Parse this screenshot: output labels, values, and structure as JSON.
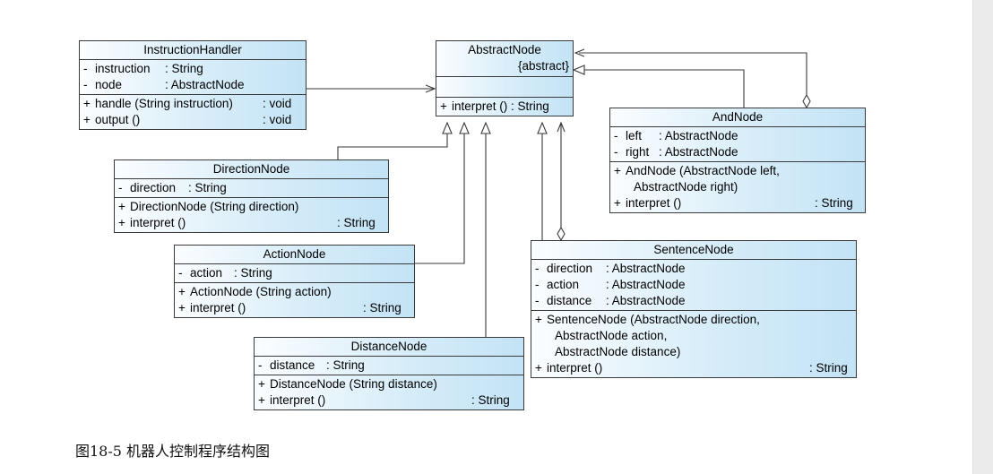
{
  "classes": {
    "instruction_handler": {
      "name": "InstructionHandler",
      "attributes": [
        {
          "vis": "-",
          "name": "instruction",
          "type": ": String"
        },
        {
          "vis": "-",
          "name": "node",
          "type": ": AbstractNode"
        }
      ],
      "operations": [
        {
          "vis": "+",
          "name": "handle (String instruction)",
          "type": ": void"
        },
        {
          "vis": "+",
          "name": "output ()",
          "type": ": void"
        }
      ]
    },
    "abstract_node": {
      "name": "AbstractNode",
      "stereotype": "{abstract}",
      "operations": [
        {
          "vis": "+",
          "name": "interpret () : String"
        }
      ]
    },
    "and_node": {
      "name": "AndNode",
      "attributes": [
        {
          "vis": "-",
          "name": "left",
          "type": ": AbstractNode"
        },
        {
          "vis": "-",
          "name": "right",
          "type": ": AbstractNode"
        }
      ],
      "operations": [
        {
          "vis": "+",
          "name": "AndNode (AbstractNode left,",
          "cont": "AbstractNode right)"
        },
        {
          "vis": "+",
          "name": "interpret ()",
          "type": ": String"
        }
      ]
    },
    "direction_node": {
      "name": "DirectionNode",
      "attributes": [
        {
          "vis": "-",
          "name": "direction",
          "type": ": String"
        }
      ],
      "operations": [
        {
          "vis": "+",
          "name": "DirectionNode (String direction)"
        },
        {
          "vis": "+",
          "name": "interpret ()",
          "type": ": String"
        }
      ]
    },
    "action_node": {
      "name": "ActionNode",
      "attributes": [
        {
          "vis": "-",
          "name": "action",
          "type": ": String"
        }
      ],
      "operations": [
        {
          "vis": "+",
          "name": "ActionNode (String action)"
        },
        {
          "vis": "+",
          "name": "interpret ()",
          "type": ": String"
        }
      ]
    },
    "distance_node": {
      "name": "DistanceNode",
      "attributes": [
        {
          "vis": "-",
          "name": "distance",
          "type": ": String"
        }
      ],
      "operations": [
        {
          "vis": "+",
          "name": "DistanceNode (String distance)"
        },
        {
          "vis": "+",
          "name": "interpret ()",
          "type": ": String"
        }
      ]
    },
    "sentence_node": {
      "name": "SentenceNode",
      "attributes": [
        {
          "vis": "-",
          "name": "direction",
          "type": ": AbstractNode"
        },
        {
          "vis": "-",
          "name": "action",
          "type": ": AbstractNode"
        },
        {
          "vis": "-",
          "name": "distance",
          "type": ": AbstractNode"
        }
      ],
      "operations": [
        {
          "vis": "+",
          "name": "SentenceNode (AbstractNode direction,",
          "cont": "AbstractNode action,",
          "cont2": "AbstractNode distance)"
        },
        {
          "vis": "+",
          "name": "interpret ()",
          "type": ": String"
        }
      ]
    }
  },
  "caption": "图18-5 机器人控制程序结构图"
}
